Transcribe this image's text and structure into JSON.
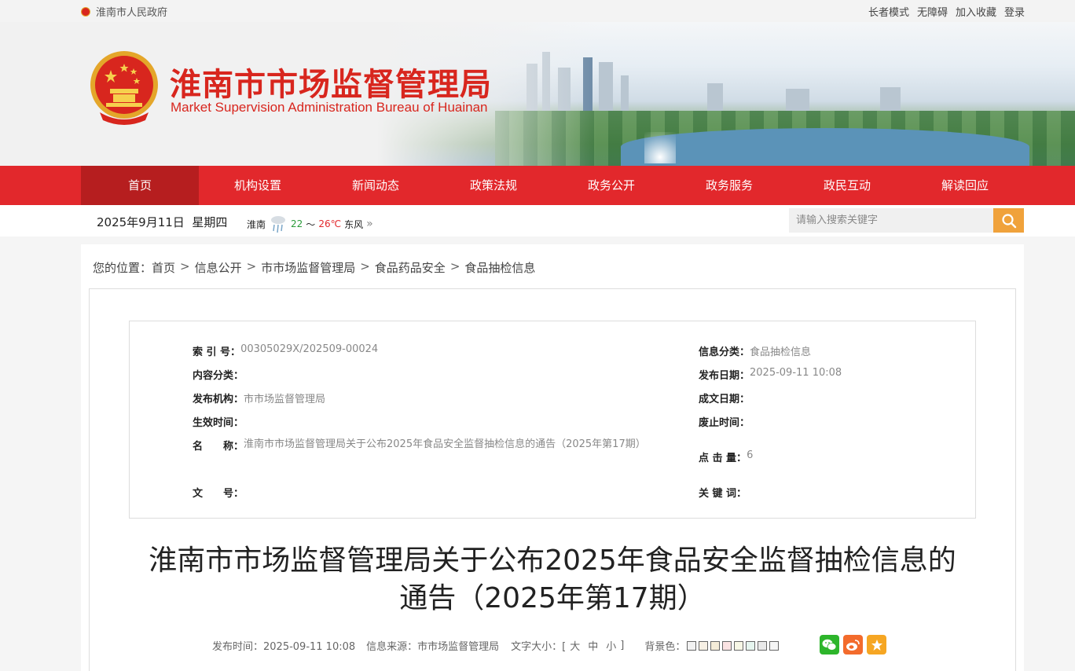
{
  "topbar": {
    "gov_link": "淮南市人民政府",
    "links": [
      "长者模式",
      "无障碍",
      "加入收藏",
      "登录"
    ]
  },
  "banner": {
    "title_cn": "淮南市市场监督管理局",
    "title_en": "Market Supervision Administration Bureau of Huainan"
  },
  "nav": {
    "items": [
      "首页",
      "机构设置",
      "新闻动态",
      "政策法规",
      "政务公开",
      "政务服务",
      "政民互动",
      "解读回应"
    ],
    "active_index": 0
  },
  "infobar": {
    "date": "2025年9月11日",
    "weekday": "星期四",
    "city": "淮南",
    "temp_low": "22",
    "temp_sep": "～",
    "temp_high": "26℃",
    "wind": "东风",
    "more": "»"
  },
  "search": {
    "placeholder": "请输入搜索关键字"
  },
  "breadcrumb": {
    "prefix": "您的位置：",
    "items": [
      "首页",
      "信息公开",
      "市市场监督管理局",
      "食品药品安全",
      "食品抽检信息"
    ],
    "separator": ">"
  },
  "meta": {
    "index_no_label": "索 引 号：",
    "index_no": "00305029X/202509-00024",
    "category_label": "信息分类：",
    "category": "食品抽检信息",
    "content_cat_label": "内容分类：",
    "content_cat": "",
    "publish_date_label": "发布日期：",
    "publish_date": "2025-09-11 10:08",
    "publisher_label": "发布机构：",
    "publisher": "市市场监督管理局",
    "created_date_label": "成文日期：",
    "created_date": "",
    "effective_label": "生效时间：",
    "effective": "",
    "repeal_label": "废止时间：",
    "repeal": "",
    "name_label": "名　　称：",
    "name": "淮南市市场监督管理局关于公布2025年食品安全监督抽检信息的通告（2025年第17期）",
    "clicks_label": "点 击 量：",
    "clicks": "6",
    "doc_no_label": "文　　号：",
    "doc_no": "",
    "keywords_label": "关 键 词：",
    "keywords": ""
  },
  "article": {
    "title_line1": "淮南市市场监督管理局关于公布2025年食品安全监督抽检信息的",
    "title_line2": "通告（2025年第17期）"
  },
  "toolbar": {
    "publish_time": "发布时间：2025-09-11 10:08",
    "source": "信息来源：市市场监督管理局",
    "font_size_label": "文字大小：[",
    "font_large": "大",
    "font_medium": "中",
    "font_small": "小",
    "font_close": "]",
    "bg_label": "背景色：",
    "bg_colors": [
      "#f2f2f2",
      "#f7f0e4",
      "#f4ecd8",
      "#fbe3e3",
      "#f7f7e6",
      "#e6f5ef",
      "#e9e9e9",
      "#f5f5f5"
    ]
  },
  "share": {
    "wechat_color": "#2db52b",
    "weibo_color": "#f36b2c",
    "fav_color": "#f6a623"
  }
}
